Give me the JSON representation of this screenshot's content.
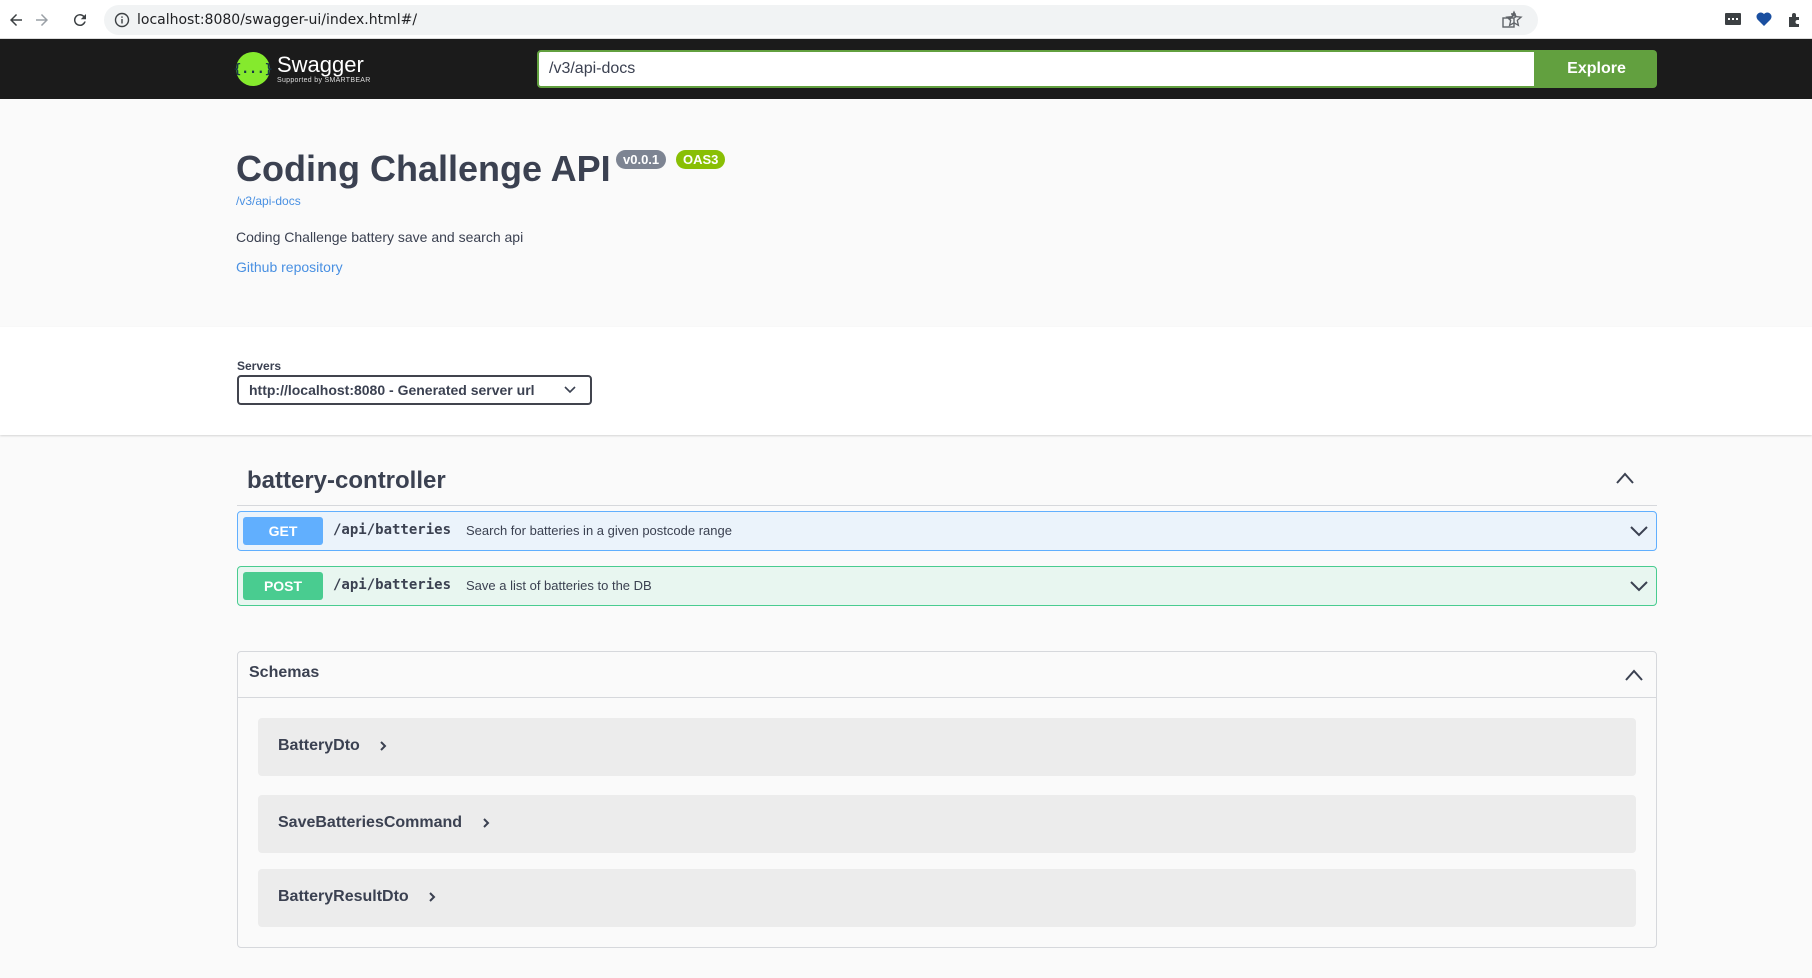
{
  "browser": {
    "url": "localhost:8080/swagger-ui/index.html#/"
  },
  "topbar": {
    "logo_name": "Swagger",
    "logo_tagline": "Supported by SMARTBEAR",
    "logo_glyph": "{...}",
    "spec_url": "/v3/api-docs",
    "explore_label": "Explore"
  },
  "info": {
    "title": "Coding Challenge API",
    "version_badge": "v0.0.1",
    "oas_badge": "OAS3",
    "spec_link": "/v3/api-docs",
    "description": "Coding Challenge battery save and search api",
    "github_link": "Github repository"
  },
  "servers": {
    "label": "Servers",
    "selected": "http://localhost:8080 - Generated server url"
  },
  "tag": {
    "name": "battery-controller"
  },
  "operations": [
    {
      "method": "GET",
      "path": "/api/batteries",
      "summary": "Search for batteries in a given postcode range"
    },
    {
      "method": "POST",
      "path": "/api/batteries",
      "summary": "Save a list of batteries to the DB"
    }
  ],
  "schemas": {
    "title": "Schemas",
    "models": [
      "BatteryDto",
      "SaveBatteriesCommand",
      "BatteryResultDto"
    ]
  },
  "colors": {
    "get": "#61affe",
    "post": "#49cc90",
    "swagger_green": "#62a03f",
    "badge_oas": "#89bf04",
    "badge_version": "#7d8492"
  }
}
